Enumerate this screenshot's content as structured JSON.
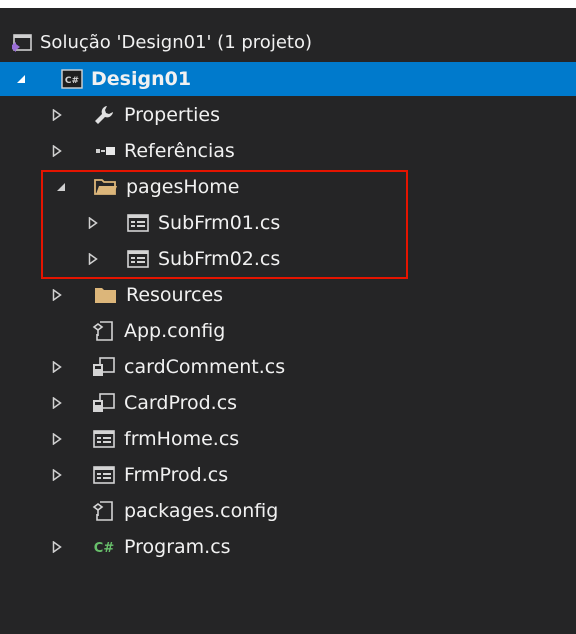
{
  "solution": {
    "label": "Solução 'Design01' (1 projeto)",
    "icon": "solution-icon"
  },
  "project": {
    "label": "Design01",
    "icon": "csharp-project-icon"
  },
  "items": [
    {
      "label": "Properties",
      "icon": "wrench-icon"
    },
    {
      "label": "Referências",
      "icon": "references-icon"
    },
    {
      "label": "pagesHome",
      "icon": "folder-open-icon"
    },
    {
      "label": "SubFrm01.cs",
      "icon": "form-file-icon"
    },
    {
      "label": "SubFrm02.cs",
      "icon": "form-file-icon"
    },
    {
      "label": "Resources",
      "icon": "folder-icon"
    },
    {
      "label": "App.config",
      "icon": "config-file-icon"
    },
    {
      "label": "cardComment.cs",
      "icon": "user-control-icon"
    },
    {
      "label": "CardProd.cs",
      "icon": "user-control-icon"
    },
    {
      "label": "frmHome.cs",
      "icon": "form-file-icon"
    },
    {
      "label": "FrmProd.cs",
      "icon": "form-file-icon"
    },
    {
      "label": "packages.config",
      "icon": "config-file-icon"
    },
    {
      "label": "Program.cs",
      "icon": "csharp-file-icon"
    }
  ],
  "colors": {
    "background": "#252526",
    "selection": "#007acc",
    "highlight_border": "#e51400",
    "folder": "#dcb67a",
    "csharp_green": "#68c06b"
  }
}
